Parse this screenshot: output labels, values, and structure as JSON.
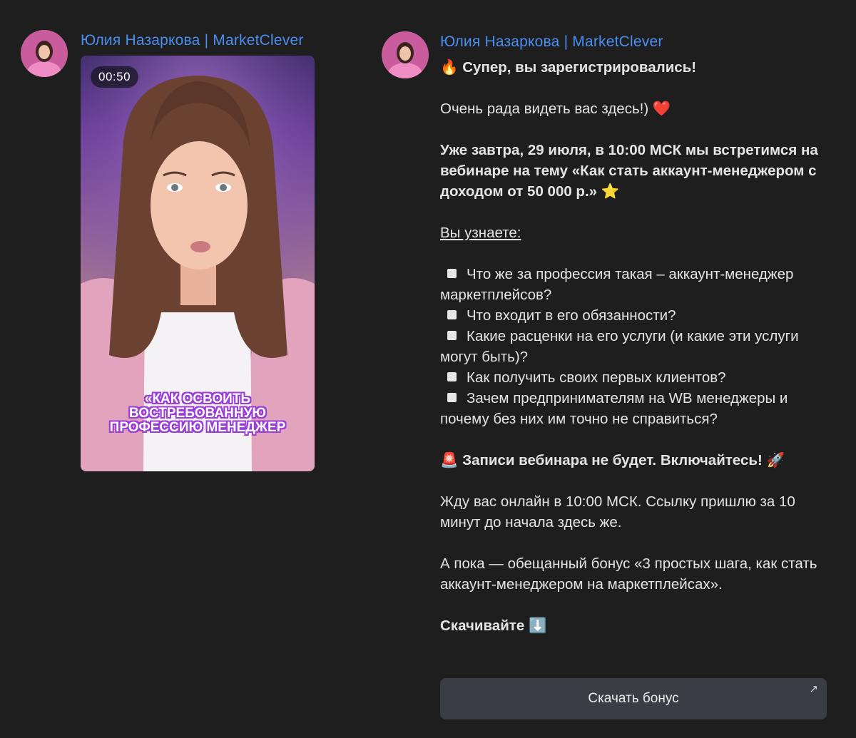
{
  "messages": [
    {
      "sender": "Юлия Назаркова | MarketClever",
      "video": {
        "duration": "00:50",
        "caption": [
          "«КАК ОСВОИТЬ",
          "ВОСТРЕБОВАННУЮ",
          "ПРОФЕССИЮ МЕНЕДЖЕР"
        ]
      }
    },
    {
      "sender": "Юлия Назаркова | MarketClever",
      "lines": {
        "title": "Супер, вы зарегистрировались!",
        "greeting": "Очень рада видеть вас здесь!)",
        "announce": "Уже завтра, 29 июля, в 10:00 МСК мы встретимся на вебинаре на тему «Как стать аккаунт-менеджером с доходом от 50 000 р.»",
        "learn_heading": "Вы узнаете:",
        "bullets": [
          "Что же за профессия такая – аккаунт-менеджер маркетплейсов?",
          "Что входит в его обязанности?",
          "Какие расценки на его услуги (и какие эти услуги могут быть)?",
          "Как получить своих первых клиентов?",
          "Зачем предпринимателям на WB менеджеры и почему без них им точно не справиться?"
        ],
        "warning": "Записи вебинара не будет. Включайтесь!",
        "online": "Жду вас онлайн в 10:00 МСК. Ссылку пришлю за 10 минут до начала здесь же.",
        "bonus": "А пока — обещанный бонус «3 простых шага, как стать аккаунт-менеджером на маркетплейсах».",
        "download_call": "Скачивайте"
      },
      "emoji": {
        "title": "🔥",
        "greeting": "❤️",
        "announce": "⭐",
        "warning_left": "🚨",
        "warning_right": "🚀",
        "download": "⬇️"
      },
      "button": {
        "label": "Скачать бонус",
        "icon": "↗"
      }
    }
  ],
  "colors": {
    "background": "#1e1e1e",
    "sender": "#4a8ef0",
    "button_bg": "#3a3d43"
  }
}
